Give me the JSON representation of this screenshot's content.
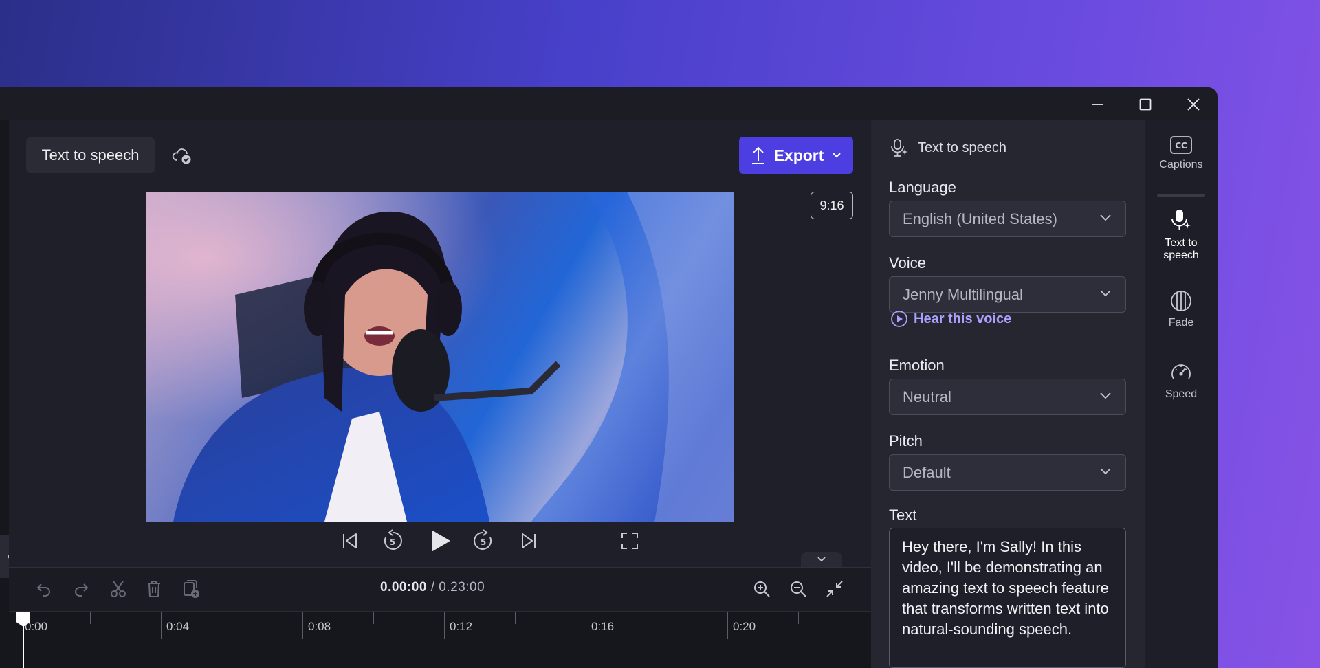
{
  "project": {
    "title": "Text to speech"
  },
  "toolbar": {
    "export_label": "Export",
    "aspect_ratio": "9:16"
  },
  "timeline": {
    "current_time": "0.00:00",
    "separator": "/",
    "total_time": "0.23:00",
    "ticks": [
      "0:00",
      "0:04",
      "0:08",
      "0:12",
      "0:16",
      "0:20"
    ]
  },
  "panel": {
    "header": "Text to speech",
    "language": {
      "label": "Language",
      "value": "English (United States)"
    },
    "voice": {
      "label": "Voice",
      "value": "Jenny Multilingual",
      "hear_label": "Hear this voice"
    },
    "emotion": {
      "label": "Emotion",
      "value": "Neutral"
    },
    "pitch": {
      "label": "Pitch",
      "value": "Default"
    },
    "text": {
      "label": "Text",
      "value": "Hey there, I'm Sally! In this video, I'll be demonstrating an amazing text to speech feature that transforms written text into natural-sounding speech."
    }
  },
  "rail": [
    {
      "label": "Captions",
      "icon": "captions-icon"
    },
    {
      "label": "Text to speech",
      "icon": "text-to-speech-icon"
    },
    {
      "label": "Fade",
      "icon": "fade-icon"
    },
    {
      "label": "Speed",
      "icon": "speed-icon"
    }
  ],
  "colors": {
    "accent": "#4c3ee0",
    "link": "#a9a0ff",
    "background_start": "#2b2f88",
    "background_end": "#8753e6"
  }
}
